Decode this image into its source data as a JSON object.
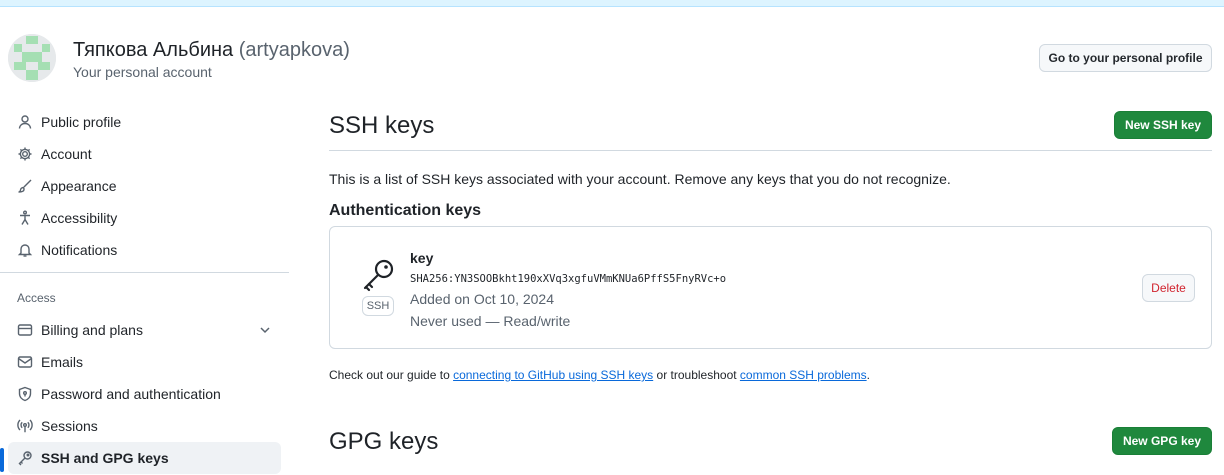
{
  "header": {
    "user_name": "Тяпкова Альбина",
    "user_login": "(artyapkova)",
    "subtitle": "Your personal account",
    "profile_button": "Go to your personal profile"
  },
  "sidebar": {
    "items": [
      {
        "label": "Public profile",
        "icon": "person-icon"
      },
      {
        "label": "Account",
        "icon": "gear-icon"
      },
      {
        "label": "Appearance",
        "icon": "paintbrush-icon"
      },
      {
        "label": "Accessibility",
        "icon": "accessibility-icon"
      },
      {
        "label": "Notifications",
        "icon": "bell-icon"
      }
    ],
    "group_label": "Access",
    "access_items": [
      {
        "label": "Billing and plans",
        "icon": "credit-card-icon"
      },
      {
        "label": "Emails",
        "icon": "mail-icon"
      },
      {
        "label": "Password and authentication",
        "icon": "shield-lock-icon"
      },
      {
        "label": "Sessions",
        "icon": "broadcast-icon"
      },
      {
        "label": "SSH and GPG keys",
        "icon": "key-icon",
        "active": true
      }
    ]
  },
  "ssh": {
    "title": "SSH keys",
    "new_button": "New SSH key",
    "intro": "This is a list of SSH keys associated with your account. Remove any keys that you do not recognize.",
    "auth_heading": "Authentication keys",
    "key": {
      "title": "key",
      "type_badge": "SSH",
      "fingerprint": "SHA256:YN3SOOBkht190xXVq3xgfuVMmKNUa6PffS5FnyRVc+o",
      "added": "Added on Oct 10, 2024",
      "usage": "Never used — Read/write",
      "delete_button": "Delete"
    },
    "guide": {
      "prefix": "Check out our guide to ",
      "link1": "connecting to GitHub using SSH keys",
      "middle": " or troubleshoot ",
      "link2": "common SSH problems",
      "suffix": "."
    }
  },
  "gpg": {
    "title": "GPG keys",
    "new_button": "New GPG key"
  },
  "colors": {
    "primary_green": "#1f883d",
    "link_blue": "#0969da",
    "danger_red": "#d1242f",
    "active_indicator": "#0969da"
  }
}
